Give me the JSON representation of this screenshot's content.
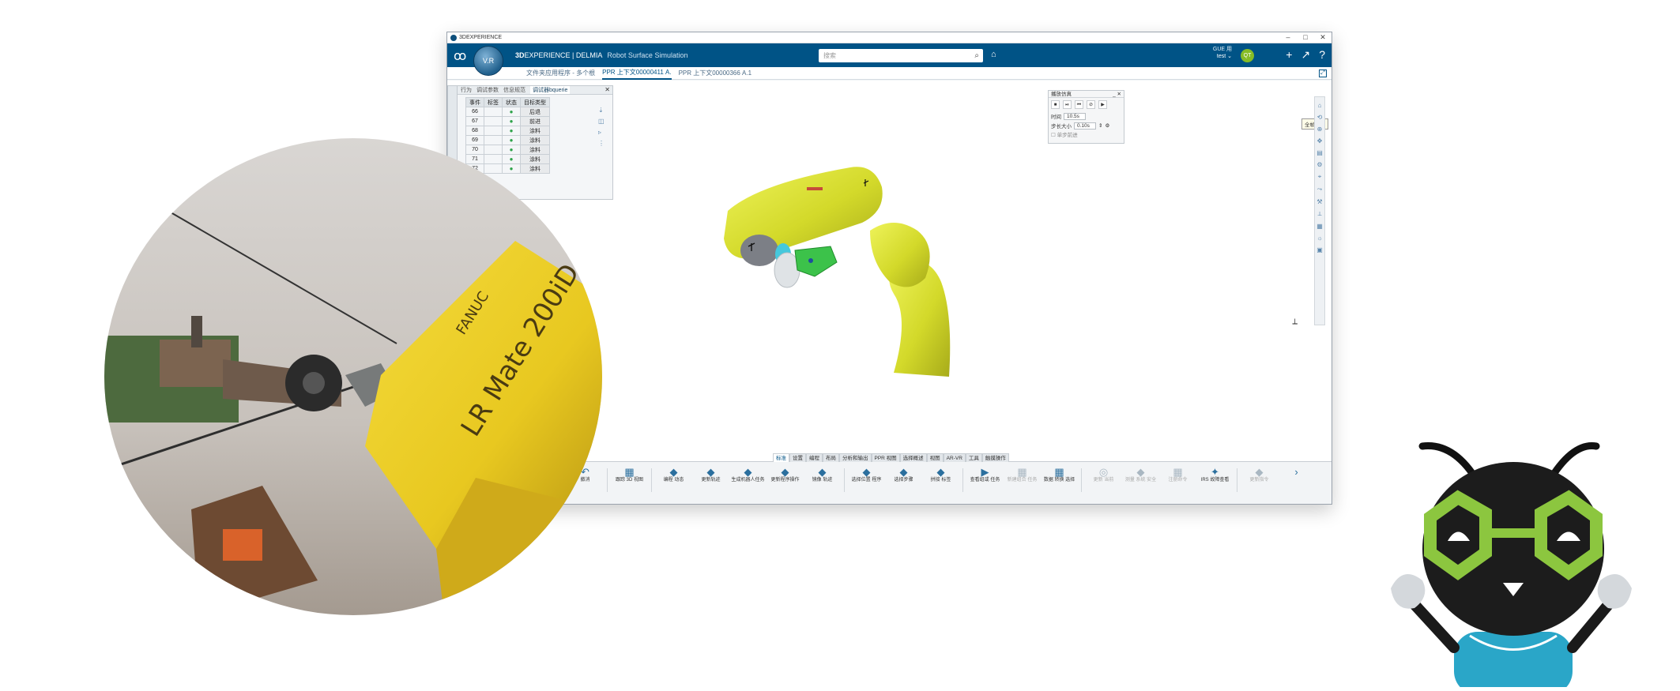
{
  "window": {
    "os_title": "3DEXPERIENCE",
    "controls": [
      "–",
      "□",
      "✕"
    ]
  },
  "app_bar": {
    "brand_strong": "3D",
    "brand_rest": "EXPERIENCE | DELMIA",
    "product": "Robot Surface Simulation",
    "compass_label": "V.R",
    "search_placeholder": "搜索",
    "user_line1": "GUE 用",
    "user_line2": "test ⌄",
    "avatar_label": "QT"
  },
  "tabs": {
    "breadcrumb": "文件夹应用程序 - 多个根",
    "active": "PPR 上下文00000411 A.",
    "other": "PPR 上下文00000366 A.1"
  },
  "panel": {
    "tabs": [
      "行为",
      "调试参数",
      "信息规范"
    ],
    "active_tab": "调试器bquerie",
    "columns": [
      "事件",
      "标签",
      "状态",
      "目标类型"
    ],
    "rows": [
      {
        "event": "66",
        "status": "●",
        "type": "后退"
      },
      {
        "event": "67",
        "status": "●",
        "type": "前进"
      },
      {
        "event": "68",
        "status": "●",
        "type": "涂料"
      },
      {
        "event": "69",
        "status": "●",
        "type": "涂料"
      },
      {
        "event": "70",
        "status": "●",
        "type": "涂料"
      },
      {
        "event": "71",
        "status": "●",
        "type": "涂料"
      },
      {
        "event": "72",
        "status": "●",
        "type": "涂料"
      }
    ]
  },
  "player": {
    "title": "播放仿真",
    "time_label": "时间",
    "time_value": "10.5s",
    "step_label": "步长大小",
    "step_value": "0.10s",
    "check_label": "单步前进",
    "tooltip": "全帧播放"
  },
  "bottom_tabs": [
    "标准",
    "设置",
    "编程",
    "布局",
    "分析和输出",
    "PPR 视图",
    "选择概述",
    "视图",
    "AR-VR",
    "工具",
    "触摸操作"
  ],
  "bottom_active_tab": "标准",
  "tools": [
    {
      "label": "撤消",
      "icon": "↶",
      "disabled": false
    },
    {
      "label": "跟踪 3D 视图",
      "icon": "▦",
      "disabled": false
    },
    {
      "label": "编程 动态",
      "icon": "◆",
      "disabled": false
    },
    {
      "label": "更新轨迹",
      "icon": "◆",
      "disabled": false
    },
    {
      "label": "生成机器人任务",
      "icon": "◆",
      "disabled": false
    },
    {
      "label": "更新程序操作",
      "icon": "◆",
      "disabled": false
    },
    {
      "label": "镜像 轨迹",
      "icon": "◆",
      "disabled": false
    },
    {
      "label": "选择位置 程序",
      "icon": "◆",
      "disabled": false
    },
    {
      "label": "选择步骤",
      "icon": "◆",
      "disabled": false
    },
    {
      "label": "拼接 标签",
      "icon": "◆",
      "disabled": false
    },
    {
      "label": "查看组或 任务",
      "icon": "▶",
      "disabled": false
    },
    {
      "label": "新建组合 任务",
      "icon": "▦",
      "disabled": true
    },
    {
      "label": "数据 转换 选择",
      "icon": "▦",
      "disabled": false
    },
    {
      "label": "更新 当前",
      "icon": "◎",
      "disabled": true
    },
    {
      "label": "测量 系统 安全",
      "icon": "◆",
      "disabled": true
    },
    {
      "label": "注册命令",
      "icon": "▦",
      "disabled": true
    },
    {
      "label": "IRS 故障查看",
      "icon": "✦",
      "disabled": false
    },
    {
      "label": "更新指令",
      "icon": "◆",
      "disabled": true
    }
  ],
  "real_robot": {
    "brand": "FANUC",
    "model": "LR Mate 200iD"
  },
  "colors": {
    "app_bar": "#005386",
    "robot_yellow": "#d6dc2a",
    "mascot_green": "#8cc63f",
    "mascot_teal": "#2aa6c8"
  }
}
